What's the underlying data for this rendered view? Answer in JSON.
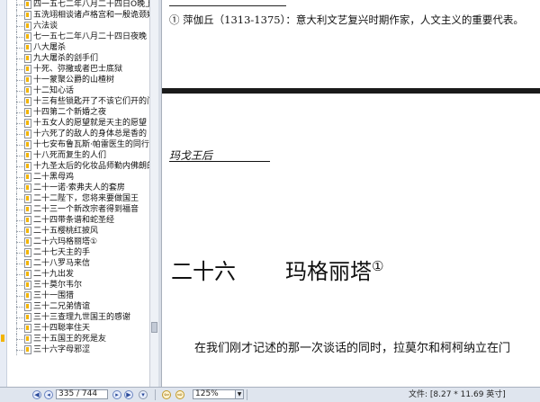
{
  "tree": {
    "items": [
      "四一五七二年八月二十四日O晚上",
      "五洗翊相谈诸卢格宫和一殷诡颈婚",
      "六法谈",
      "七一五七二年八月二十四日夜晚",
      "八大屠杀",
      "九大屠杀的刽手们",
      "十死、弥撒或者巴士底狱",
      "十一蒙聚公爵的山楂树",
      "十二知心话",
      "十三有些锁匙开了不该它们开的门",
      "十四第二个新婚之夜",
      "十五女人的愿望就是天主的愿望",
      "十六死了的敌人的身体总是香的",
      "十七安布鲁瓦斯·帕雷医生的同行",
      "十八死而复生的人们",
      "十九圣太后的化妆品师勤内佛朗的",
      "二十黑母鸡",
      "二十一诺·索弗夫人的套房",
      "二十二陛下，您将来要做国王",
      "二十三一个新改宗者得到福音",
      "二十四带条谱和蛇圣经",
      "二十五樱桃红披风",
      "二十六玛格丽塔①",
      "二十七天主的手",
      "二十八罗马来信",
      "二十九出发",
      "三十莫尔韦尔",
      "三十一围猎",
      "三十二兄弟情谊",
      "三十三查理九世国王的感谢",
      "三十四聪率住天",
      "三十五国王的死是友",
      "三十六字母邪涩"
    ]
  },
  "page": {
    "footnote": "① 萍伽丘（1313-1375）：意大利文艺复兴时期作家，人文主义的重要代表。",
    "running_head": "玛戈王后",
    "chapter_number": "二十六",
    "chapter_title": "玛格丽塔",
    "chapter_note": "①",
    "body_first_line": "在我们刚才记述的那一次谈话的同时，拉莫尔和柯柯纳立在门"
  },
  "status": {
    "page_indicator": "335 / 744",
    "zoom": "125%",
    "file_size": "文件: [8.27 * 11.69 英寸]"
  },
  "icons": {
    "first": "first-page-icon",
    "prev": "previous-page-icon",
    "next": "next-page-icon",
    "last": "last-page-icon",
    "back": "back-icon",
    "forward": "forward-icon"
  },
  "colors": {
    "accent": "#f2b400",
    "statusbar": "#dfe5ee",
    "page_divider": "#1a1a1a"
  }
}
